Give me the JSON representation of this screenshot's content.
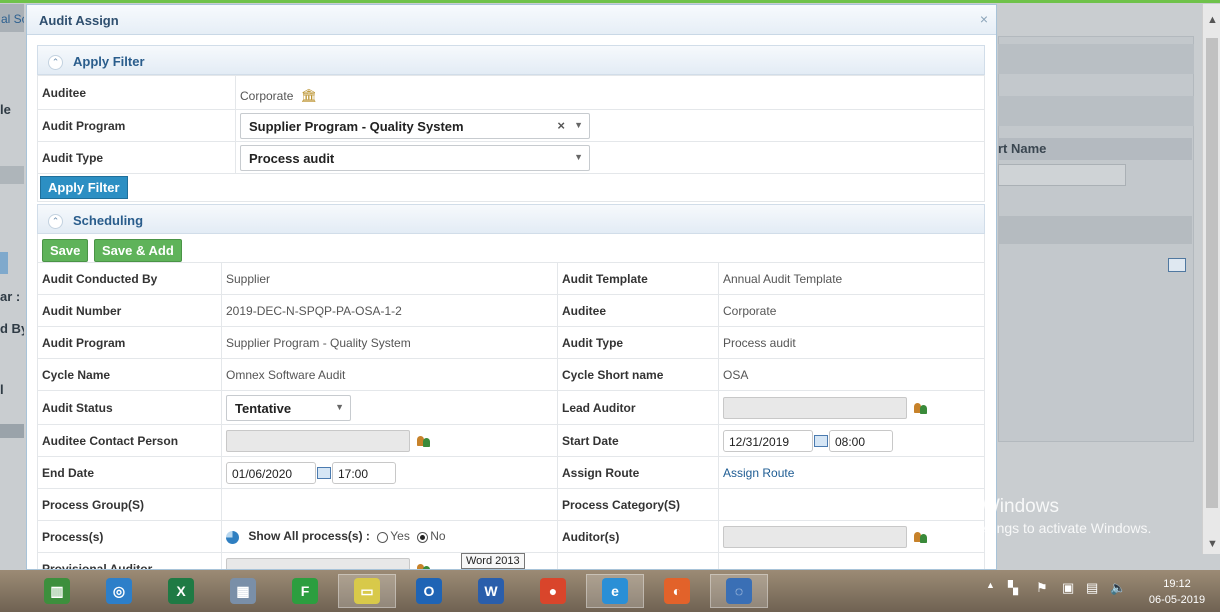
{
  "background": {
    "left_tab_text": "al Sc",
    "left_items": [
      "le",
      "ar :",
      "d By",
      "l"
    ],
    "right_col_title": "rt Name",
    "watermark_title": "Activate Windows",
    "watermark_sub": "to PC settings to activate Windows."
  },
  "modal": {
    "title": "Audit Assign",
    "close_glyph": "×"
  },
  "filter": {
    "section_title": "Apply Filter",
    "collapse_glyph": "⌃",
    "auditee_label": "Auditee",
    "auditee_value": "Corporate",
    "program_label": "Audit Program",
    "program_value": "Supplier Program - Quality System",
    "type_label": "Audit Type",
    "type_value": "Process audit",
    "apply_button": "Apply Filter"
  },
  "scheduling": {
    "section_title": "Scheduling",
    "save_button": "Save",
    "save_add_button": "Save & Add",
    "rows": {
      "conducted_by_label": "Audit Conducted By",
      "conducted_by_value": "Supplier",
      "template_label": "Audit Template",
      "template_value": "Annual Audit Template",
      "number_label": "Audit Number",
      "number_value": "2019-DEC-N-SPQP-PA-OSA-1-2",
      "auditee_label": "Auditee",
      "auditee_value": "Corporate",
      "program_label": "Audit Program",
      "program_value": "Supplier Program - Quality System",
      "type_label": "Audit Type",
      "type_value": "Process audit",
      "cycle_label": "Cycle Name",
      "cycle_value": "Omnex Software Audit",
      "cycle_short_label": "Cycle Short name",
      "cycle_short_value": "OSA",
      "status_label": "Audit Status",
      "status_value": "Tentative",
      "lead_label": "Lead Auditor",
      "contact_label": "Auditee Contact Person",
      "start_label": "Start Date",
      "start_date": "12/31/2019",
      "start_time": "08:00",
      "end_label": "End Date",
      "end_date": "01/06/2020",
      "end_time": "17:00",
      "route_label": "Assign Route",
      "route_link": "Assign Route",
      "group_label": "Process Group(S)",
      "category_label": "Process Category(S)",
      "process_label": "Process(s)",
      "show_all_label": "Show All process(s) :",
      "yes_label": "Yes",
      "no_label": "No",
      "auditors_label": "Auditor(s)",
      "provisional_label": "Provisional Auditor"
    }
  },
  "tooltip": "Word 2013",
  "taskbar": {
    "apps": [
      {
        "name": "task-manager",
        "glyph": "▥",
        "color": "#3d8f3d"
      },
      {
        "name": "safari",
        "glyph": "◎",
        "color": "#2d7fc9"
      },
      {
        "name": "excel",
        "glyph": "X",
        "color": "#1f7a44"
      },
      {
        "name": "calculator",
        "glyph": "▦",
        "color": "#7a8fa8"
      },
      {
        "name": "green-app",
        "glyph": "F",
        "color": "#2c9e3f"
      },
      {
        "name": "sticky-notes",
        "glyph": "▭",
        "color": "#d8c94a"
      },
      {
        "name": "outlook",
        "glyph": "O",
        "color": "#1f64b5"
      },
      {
        "name": "word",
        "glyph": "W",
        "color": "#2a5eab"
      },
      {
        "name": "chrome",
        "glyph": "●",
        "color": "#d9452b"
      },
      {
        "name": "internet-explorer",
        "glyph": "e",
        "color": "#2a8fd6"
      },
      {
        "name": "firefox",
        "glyph": "◐",
        "color": "#e2622a"
      },
      {
        "name": "sync-app",
        "glyph": "◌",
        "color": "#3a6fb5"
      }
    ],
    "time": "19:12",
    "date": "06-05-2019"
  }
}
